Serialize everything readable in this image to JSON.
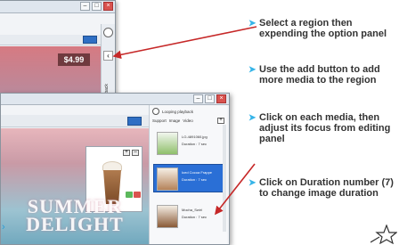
{
  "annotations": [
    {
      "lines": [
        "Select a region then",
        "expending the option panel"
      ]
    },
    {
      "lines": [
        "Use the add button to add",
        "more media to the region"
      ]
    },
    {
      "lines": [
        "Click on each media, then",
        "adjust its focus from editing",
        "panel"
      ]
    },
    {
      "lines": [
        "Click on Duration number (7)",
        "to change image duration"
      ]
    }
  ],
  "back_window": {
    "price": "$4.99",
    "side_label": "Looping playback"
  },
  "front_window": {
    "canvas_text_1": "SUMMER",
    "canvas_text_2": "DELIGHT",
    "panel": {
      "title": "Looping playback",
      "tab_support": "Support",
      "tab_image": "Image",
      "tab_video": "Video",
      "add_label": "+"
    },
    "media": [
      {
        "name": "LO-4891060.jpg",
        "duration": "Duration : 7 sec"
      },
      {
        "name": "Iced Cocoa Frappe",
        "duration": "Duration : 7 sec"
      },
      {
        "name": "Mocha_Swirl",
        "duration": "Duration : 7 sec"
      }
    ]
  },
  "colors": {
    "accent": "#2a6fd6",
    "arrow": "#c62828",
    "bullet": "#35b4e8"
  }
}
